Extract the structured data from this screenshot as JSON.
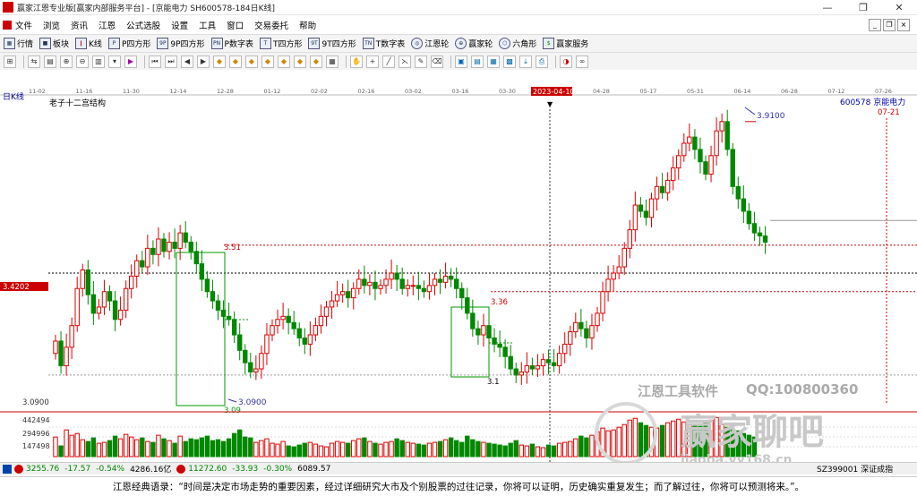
{
  "window": {
    "title": "赢家江恩专业版[赢家内部服务平台] - [京能电力  SH600578-184日K线]",
    "controls": [
      "—",
      "❐",
      "✕"
    ]
  },
  "menu": [
    "文件",
    "浏览",
    "资讯",
    "江恩",
    "公式选股",
    "设置",
    "工具",
    "窗口",
    "交易委托",
    "帮助"
  ],
  "menu_right": [
    "_",
    "❐",
    "×"
  ],
  "toolbar1": [
    {
      "icon": "grid-icon",
      "label": "行情"
    },
    {
      "icon": "blocks-icon",
      "label": "板块"
    },
    {
      "icon": "kline-icon",
      "label": "K线"
    },
    {
      "icon": "p-square-icon",
      "label": "P四方形"
    },
    {
      "icon": "9p-square-icon",
      "label": "9P四方形"
    },
    {
      "icon": "pn-square-icon",
      "label": "P数字表"
    },
    {
      "icon": "t-square-icon",
      "label": "T四方形"
    },
    {
      "icon": "9t-square-icon",
      "label": "9T四方形"
    },
    {
      "icon": "tn-square-icon",
      "label": "T数字表"
    },
    {
      "icon": "gann-wheel-icon",
      "label": "江恩轮"
    },
    {
      "icon": "winner-wheel-icon",
      "label": "赢家轮"
    },
    {
      "icon": "hexagon-icon",
      "label": "六角形"
    },
    {
      "icon": "service-icon",
      "label": "赢家服务"
    }
  ],
  "chart_header": {
    "period": "日K线",
    "indicator": "老子十二宫结构",
    "code_name": "600578  京能电力",
    "cursor_date": "2023-04-10",
    "future_date": "07-21"
  },
  "date_ticks": [
    "11-02",
    "11-16",
    "11-30",
    "12-14",
    "12-28",
    "01-12",
    "02-02",
    "02-16",
    "03-02",
    "03-16",
    "03-30",
    "04-14",
    "04-28",
    "05-17",
    "05-31",
    "06-14",
    "06-28",
    "07-12",
    "07-26"
  ],
  "annotations": {
    "high_label": "3.9100",
    "low_label": "3.0900",
    "low_box_label": "3.09",
    "level_351": "3.51",
    "level_336": "3.36",
    "level_31": "3.1",
    "price_tag": "3.4202",
    "bottom_price": "3.0900"
  },
  "volume_axis": [
    "442494",
    "294996",
    "147498"
  ],
  "bottom_bar": {
    "sh": "3255.76",
    "sh_chg": "-17.57",
    "sh_pct": "-0.54%",
    "sh_amt": "4286.16亿",
    "sz": "11272.60",
    "sz_chg": "-33.93",
    "sz_pct": "-0.30%",
    "sz_amt": "6089.57",
    "right": "SZ399001 深证成指"
  },
  "quote": "江恩经典语录：“时间是决定市场走势的重要因素，经过详细研究大市及个别股票的过往记录，你将可以证明，历史确实重复发生；而了解过往，你将可以预测将来。”。",
  "watermarks": {
    "software": "江恩工具软件",
    "qq": "QQ:100800360",
    "site": "赢家聊吧",
    "url": "jiaoba.yy168.cn"
  },
  "chart_data": {
    "type": "candlestick",
    "title": "老子十二宫结构",
    "ylim": [
      3.0,
      3.95
    ],
    "levels": [
      3.51,
      3.42,
      3.36,
      3.09,
      3.91
    ],
    "close": [
      3.2,
      3.12,
      3.18,
      3.25,
      3.37,
      3.43,
      3.35,
      3.29,
      3.31,
      3.36,
      3.33,
      3.27,
      3.3,
      3.37,
      3.41,
      3.46,
      3.44,
      3.5,
      3.48,
      3.53,
      3.49,
      3.52,
      3.5,
      3.55,
      3.52,
      3.49,
      3.45,
      3.4,
      3.36,
      3.33,
      3.3,
      3.28,
      3.27,
      3.22,
      3.17,
      3.13,
      3.1,
      3.11,
      3.16,
      3.22,
      3.25,
      3.27,
      3.28,
      3.26,
      3.24,
      3.21,
      3.19,
      3.22,
      3.25,
      3.28,
      3.31,
      3.33,
      3.35,
      3.36,
      3.34,
      3.37,
      3.4,
      3.38,
      3.39,
      3.37,
      3.38,
      3.4,
      3.42,
      3.4,
      3.37,
      3.38,
      3.38,
      3.37,
      3.36,
      3.38,
      3.4,
      3.39,
      3.41,
      3.4,
      3.37,
      3.34,
      3.29,
      3.24,
      3.22,
      3.25,
      3.21,
      3.19,
      3.18,
      3.15,
      3.11,
      3.09,
      3.1,
      3.12,
      3.11,
      3.12,
      3.14,
      3.13,
      3.12,
      3.16,
      3.19,
      3.23,
      3.26,
      3.24,
      3.21,
      3.25,
      3.29,
      3.36,
      3.4,
      3.42,
      3.44,
      3.5,
      3.56,
      3.64,
      3.62,
      3.6,
      3.66,
      3.7,
      3.68,
      3.72,
      3.76,
      3.8,
      3.84,
      3.86,
      3.82,
      3.78,
      3.74,
      3.8,
      3.88,
      3.91,
      3.82,
      3.7,
      3.66,
      3.62,
      3.58,
      3.55,
      3.54,
      3.52
    ],
    "volume": [
      220000,
      120000,
      300000,
      240000,
      260000,
      190000,
      170000,
      210000,
      150000,
      160000,
      180000,
      230000,
      200000,
      250000,
      220000,
      190000,
      210000,
      170000,
      160000,
      240000,
      200000,
      180000,
      150000,
      230000,
      170000,
      200000,
      190000,
      210000,
      230000,
      180000,
      190000,
      170000,
      200000,
      260000,
      300000,
      220000,
      210000,
      160000,
      180000,
      200000,
      150000,
      140000,
      170000,
      120000,
      110000,
      130000,
      150000,
      160000,
      140000,
      120000,
      110000,
      150000,
      170000,
      160000,
      150000,
      180000,
      200000,
      210000,
      170000,
      150000,
      140000,
      160000,
      170000,
      200000,
      180000,
      160000,
      150000,
      140000,
      130000,
      150000,
      160000,
      170000,
      190000,
      210000,
      180000,
      160000,
      230000,
      190000,
      170000,
      160000,
      150000,
      140000,
      130000,
      120000,
      150000,
      180000,
      130000,
      120000,
      140000,
      110000,
      100000,
      130000,
      120000,
      150000,
      160000,
      170000,
      200000,
      230000,
      210000,
      240000,
      280000,
      320000,
      290000,
      300000,
      330000,
      360000,
      410000,
      430000,
      380000,
      350000,
      330000,
      320000,
      350000,
      380000,
      400000,
      420000,
      390000,
      370000,
      360000,
      340000,
      380000,
      410000,
      440000,
      360000,
      330000,
      310000,
      290000,
      260000,
      240000,
      220000
    ]
  }
}
